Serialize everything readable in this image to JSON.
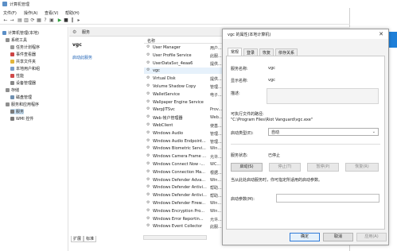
{
  "mmc": {
    "title": "计算机管理",
    "menu": [
      "文件(F)",
      "操作(A)",
      "查看(V)",
      "帮助(H)"
    ],
    "tree": [
      {
        "label": "计算机管理(本地)",
        "level": 0
      },
      {
        "label": "系统工具",
        "level": 1
      },
      {
        "label": "任务计划程序",
        "level": 2
      },
      {
        "label": "事件查看器",
        "level": 2
      },
      {
        "label": "共享文件夹",
        "level": 2
      },
      {
        "label": "本地用户和组",
        "level": 2
      },
      {
        "label": "性能",
        "level": 2
      },
      {
        "label": "设备管理器",
        "level": 2
      },
      {
        "label": "存储",
        "level": 1
      },
      {
        "label": "磁盘管理",
        "level": 2
      },
      {
        "label": "服务和应用程序",
        "level": 1
      },
      {
        "label": "服务",
        "level": 2
      },
      {
        "label": "WMI 控件",
        "level": 2
      }
    ],
    "services_header": "服务",
    "selected_service_name": "vgc",
    "start_link": "启动此服务",
    "list_header": {
      "name": "名称"
    },
    "services": [
      {
        "name": "User Manager",
        "rest": "用户..."
      },
      {
        "name": "User Profile Service",
        "rest": "此服..."
      },
      {
        "name": "UserDataSvc_4eaa6",
        "rest": "提供..."
      },
      {
        "name": "vgc",
        "rest": ""
      },
      {
        "name": "Virtual Disk",
        "rest": "提供..."
      },
      {
        "name": "Volume Shadow Copy",
        "rest": "管理..."
      },
      {
        "name": "WalletService",
        "rest": "电子..."
      },
      {
        "name": "Wallpaper Engine Service",
        "rest": ""
      },
      {
        "name": "WarpJITSvc",
        "rest": "Prov..."
      },
      {
        "name": "Web 帐户管理器",
        "rest": "Web..."
      },
      {
        "name": "WebClient",
        "rest": "使基..."
      },
      {
        "name": "Windows Audio",
        "rest": "管理..."
      },
      {
        "name": "Windows Audio Endpoint...",
        "rest": "管理..."
      },
      {
        "name": "Windows Biometric Servi...",
        "rest": "Win..."
      },
      {
        "name": "Windows Camera Frame ...",
        "rest": "允许..."
      },
      {
        "name": "Windows Connect Now -...",
        "rest": "WC..."
      },
      {
        "name": "Windows Connection Ma...",
        "rest": "根据..."
      },
      {
        "name": "Windows Defender Adva...",
        "rest": "Win..."
      },
      {
        "name": "Windows Defender Antivi...",
        "rest": "帮助..."
      },
      {
        "name": "Windows Defender Antivi...",
        "rest": "帮助..."
      },
      {
        "name": "Windows Defender Firew...",
        "rest": "Win..."
      },
      {
        "name": "Windows Encryption Pro...",
        "rest": "Win..."
      },
      {
        "name": "Windows Error Reportin...",
        "rest": "允许..."
      },
      {
        "name": "Windows Event Collector",
        "rest": "此服..."
      }
    ],
    "bottom_tabs": [
      "扩展",
      "标准"
    ]
  },
  "dialog": {
    "title": "vgc 的属性(本地计算机)",
    "tabs": [
      "常规",
      "登录",
      "恢复",
      "依存关系"
    ],
    "service_name_label": "服务名称:",
    "service_name": "vgc",
    "display_name_label": "显示名称:",
    "display_name": "vgc",
    "description_label": "描述:",
    "exe_path_label": "可执行文件的路径:",
    "exe_path": "\"C:\\Program Files\\Riot Vanguard\\vgc.exe\"",
    "startup_type_label": "启动类型(E):",
    "startup_type": "自动",
    "status_label": "服务状态:",
    "status": "已停止",
    "buttons": {
      "start": "启动(S)",
      "stop": "停止(T)",
      "pause": "暂停(P)",
      "resume": "恢复(R)"
    },
    "hint": "当从此处启动服务时，你可指定所适用的启动参数。",
    "params_label": "启动参数(M):",
    "ok": "确定",
    "cancel": "取消",
    "apply": "应用(A)"
  },
  "colors": {
    "accent": "#1e7fd8",
    "selection": "#cce4f7",
    "link": "#1a5fb4"
  }
}
